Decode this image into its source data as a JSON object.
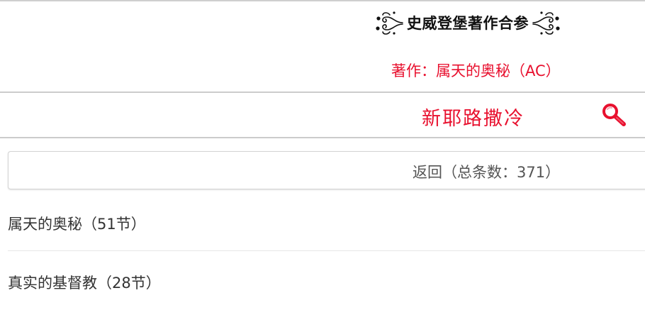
{
  "header": {
    "title": "史威登堡著作合参",
    "subtitle_prefix": "著作：",
    "subtitle_work": "属天的奥秘（AC）"
  },
  "section": {
    "title": "新耶路撒冷",
    "search_icon": "magnifier-icon"
  },
  "back": {
    "label": "返回（总条数：371）"
  },
  "list": {
    "items": [
      {
        "label": "属天的奥秘（51节）"
      },
      {
        "label": "真实的基督教（28节）"
      }
    ]
  },
  "colors": {
    "accent": "#e8102e",
    "text": "#333333",
    "muted": "#555555",
    "rule": "#cccccc"
  }
}
